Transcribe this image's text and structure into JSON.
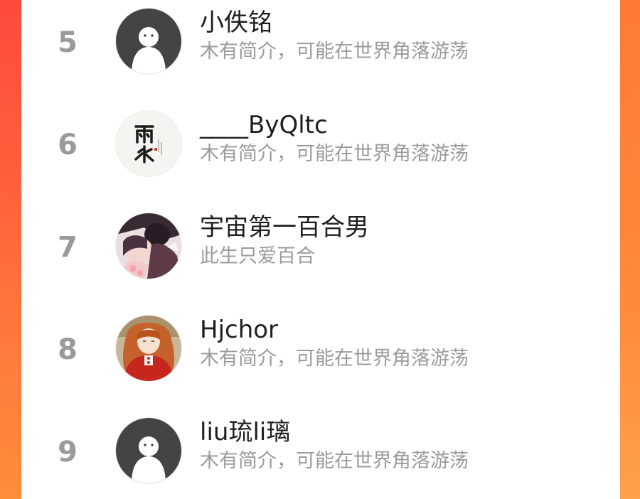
{
  "ranking": [
    {
      "rank": "5",
      "name": "小佚铭",
      "bio": "木有简介，可能在世界角落游荡",
      "avatar": "default-user-icon"
    },
    {
      "rank": "6",
      "name": "____ByQltc",
      "bio": "木有简介，可能在世界角落游荡",
      "avatar": "calligraphy-avatar"
    },
    {
      "rank": "7",
      "name": "宇宙第一百合男",
      "bio": "此生只爱百合",
      "avatar": "anime-couple-avatar"
    },
    {
      "rank": "8",
      "name": "Hjchor",
      "bio": "木有简介，可能在世界角落游荡",
      "avatar": "red-hair-girl-avatar"
    },
    {
      "rank": "9",
      "name": "liu琉li璃",
      "bio": "木有简介，可能在世界角落游荡",
      "avatar": "default-user-icon"
    }
  ],
  "colors": {
    "accent": "#ff5a3c",
    "rank": "#9a9a9a",
    "name": "#1f1f1f",
    "bio": "#9b9b9b"
  }
}
